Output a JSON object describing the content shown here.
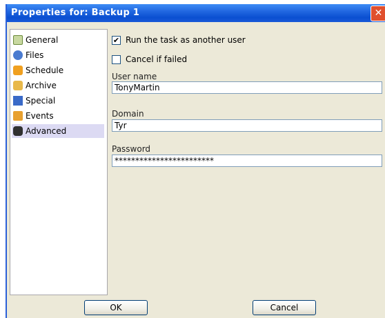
{
  "window": {
    "title": "Properties for: Backup 1",
    "close_glyph": "✕"
  },
  "sidebar": {
    "items": [
      {
        "label": "General",
        "icon": "general-icon"
      },
      {
        "label": "Files",
        "icon": "files-icon"
      },
      {
        "label": "Schedule",
        "icon": "schedule-icon"
      },
      {
        "label": "Archive",
        "icon": "archive-icon"
      },
      {
        "label": "Special",
        "icon": "special-icon"
      },
      {
        "label": "Events",
        "icon": "events-icon"
      },
      {
        "label": "Advanced",
        "icon": "advanced-icon",
        "selected": true
      }
    ]
  },
  "advanced": {
    "run_as_user": {
      "label": "Run the task as another user",
      "checked": true,
      "mark": "✔"
    },
    "cancel_if_failed": {
      "label": "Cancel if failed",
      "checked": false,
      "mark": ""
    },
    "username": {
      "label": "User name",
      "value": "TonyMartin"
    },
    "domain": {
      "label": "Domain",
      "value": "Tyr"
    },
    "password": {
      "label": "Password",
      "value": "************************"
    }
  },
  "buttons": {
    "ok": {
      "label": "OK"
    },
    "cancel": {
      "label": "Cancel"
    }
  }
}
